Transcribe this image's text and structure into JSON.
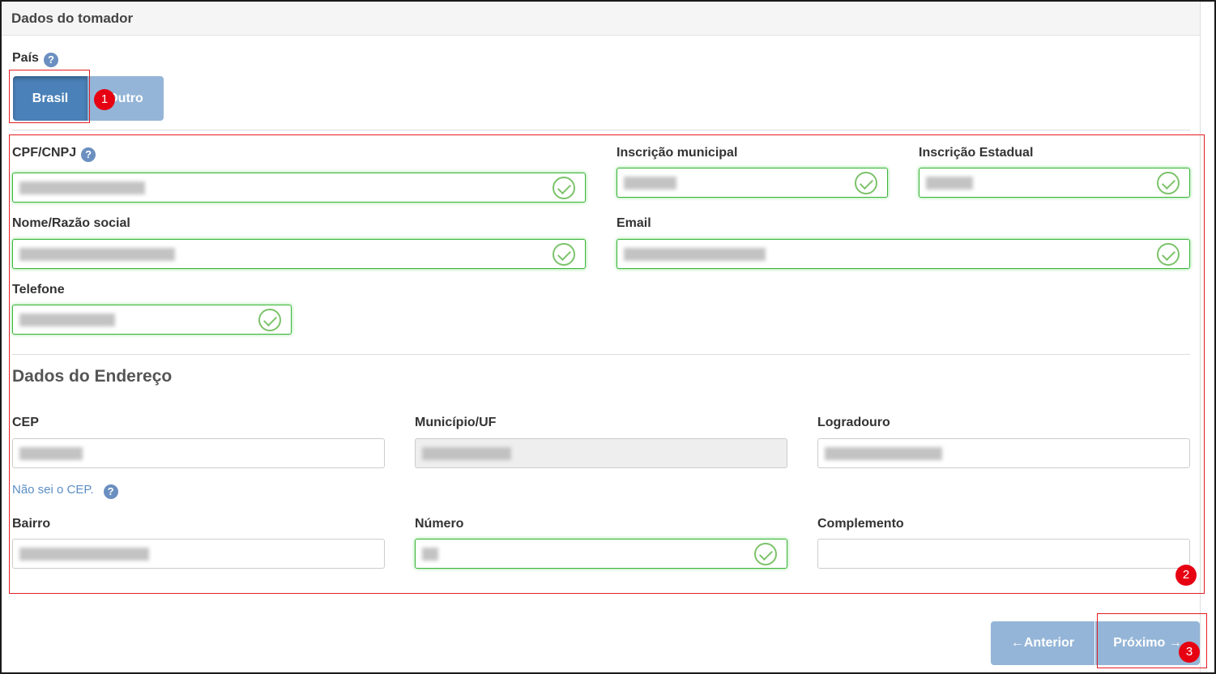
{
  "header": {
    "title": "Dados do tomador"
  },
  "country": {
    "label": "País",
    "options": [
      "Brasil",
      "Outro"
    ],
    "selected": "Brasil"
  },
  "fields": {
    "cpf_cnpj": "CPF/CNPJ",
    "inscricao_municipal": "Inscrição municipal",
    "inscricao_estadual": "Inscrição Estadual",
    "nome": "Nome/Razão social",
    "email": "Email",
    "telefone": "Telefone"
  },
  "address": {
    "title": "Dados do Endereço",
    "cep": "CEP",
    "municipio": "Município/UF",
    "logradouro": "Logradouro",
    "cep_link": "Não sei o CEP.",
    "bairro": "Bairro",
    "numero": "Número",
    "complemento": "Complemento"
  },
  "nav": {
    "previous": "←Anterior",
    "next": "Próximo →"
  },
  "annotations": [
    "1",
    "2",
    "3"
  ],
  "colors": {
    "accent": "#4a81b8",
    "valid": "#3ab53a",
    "annotation": "#e31e24"
  }
}
